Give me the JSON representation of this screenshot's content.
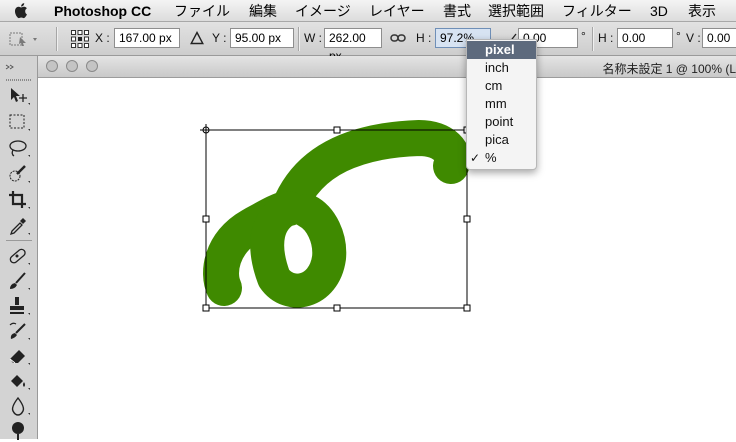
{
  "menubar": {
    "app_name": "Photoshop CC",
    "items": [
      "ファイル",
      "編集",
      "イメージ",
      "レイヤー",
      "書式",
      "選択範囲",
      "フィルター",
      "3D",
      "表示"
    ]
  },
  "options_bar": {
    "x_label": "X :",
    "x_value": "167.00 px",
    "y_label": "Y :",
    "y_value": "95.00 px",
    "w_label": "W :",
    "w_value": "262.00 px",
    "h_label": "H :",
    "h_value": "97.2%",
    "angle_value": "0.00",
    "angle_unit": "°",
    "hskew_label": "H :",
    "hskew_value": "0.00",
    "hskew_unit": "°",
    "vskew_label": "V :",
    "vskew_value": "0.00"
  },
  "document": {
    "title": "名称未設定 1 @ 100% (L"
  },
  "unit_menu": {
    "options": [
      "pixel",
      "inch",
      "cm",
      "mm",
      "point",
      "pica",
      "%"
    ],
    "highlighted": "pixel",
    "checked": "%",
    "check_mark": "✓"
  },
  "colors": {
    "brush": "#3f8a00",
    "highlight": "#5d6a7d"
  }
}
